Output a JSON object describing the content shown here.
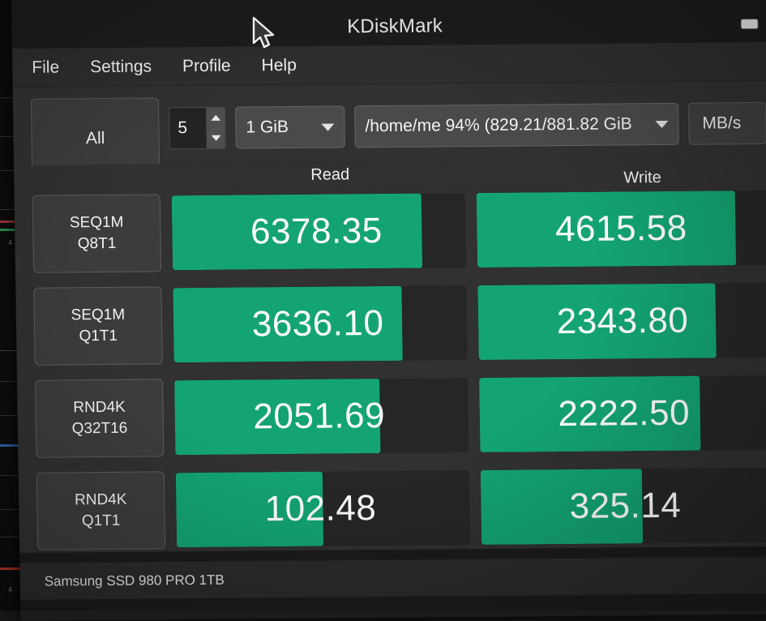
{
  "window": {
    "title": "KDiskMark",
    "minimize_label": "minimize"
  },
  "menu": {
    "items": [
      {
        "label": "File"
      },
      {
        "label": "Settings"
      },
      {
        "label": "Profile"
      },
      {
        "label": "Help"
      }
    ]
  },
  "toolbar": {
    "all_button_label": "All",
    "loops_value": "5",
    "size_value": "1 GiB",
    "path_value": "/home/me 94% (829.21/881.82 GiB",
    "unit_value": "MB/s"
  },
  "columns": {
    "read_header": "Read",
    "write_header": "Write"
  },
  "statusbar": {
    "device": "Samsung SSD 980 PRO 1TB"
  },
  "colors": {
    "bar_fill": "#13a472",
    "bar_track": "#262626",
    "window_bg": "#313131",
    "text": "#ffffff"
  },
  "chart_data": {
    "type": "bar",
    "title": "KDiskMark benchmark results",
    "unit": "MB/s",
    "categories": [
      "SEQ1M Q8T1",
      "SEQ1M Q1T1",
      "RND4K Q32T16",
      "RND4K Q1T1"
    ],
    "series": [
      {
        "name": "Read",
        "values": [
          6378.35,
          3636.1,
          2051.69,
          102.48
        ]
      },
      {
        "name": "Write",
        "values": [
          4615.58,
          2343.8,
          2222.5,
          325.14
        ]
      }
    ],
    "legend_position": "top",
    "grid": false
  },
  "results": {
    "rows": [
      {
        "test": "SEQ1M",
        "queue": "Q8T1",
        "read": {
          "value": "6378.35",
          "fill_pct": "85%"
        },
        "write": {
          "value": "4615.58",
          "fill_pct": "88%"
        }
      },
      {
        "test": "SEQ1M",
        "queue": "Q1T1",
        "read": {
          "value": "3636.10",
          "fill_pct": "78%"
        },
        "write": {
          "value": "2343.80",
          "fill_pct": "81%"
        }
      },
      {
        "test": "RND4K",
        "queue": "Q32T16",
        "read": {
          "value": "2051.69",
          "fill_pct": "70%"
        },
        "write": {
          "value": "2222.50",
          "fill_pct": "75%"
        }
      },
      {
        "test": "RND4K",
        "queue": "Q1T1",
        "read": {
          "value": "102.48",
          "fill_pct": "50%"
        },
        "write": {
          "value": "325.14",
          "fill_pct": "55%"
        }
      }
    ]
  }
}
